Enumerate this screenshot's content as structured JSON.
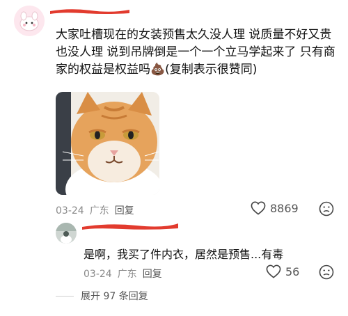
{
  "comment": {
    "text": "大家吐槽现在的女装预售太久没人理 说质量不好又贵也没人理 说到吊牌倒是一个一个立马学起来了 只有商家的权益是权益吗",
    "emoji": "💩",
    "text_suffix": "(复制表示很赞同)",
    "date": "03-24",
    "location": "广东",
    "reply_label": "回复",
    "likes": "8869",
    "icons": {
      "like": "heart-icon",
      "dislike": "dislike-face-icon"
    }
  },
  "reply": {
    "text": "是啊，我买了件内衣，居然是预售...有毒",
    "date": "03-24",
    "location": "广东",
    "reply_label": "回复",
    "likes": "56"
  },
  "expand": {
    "label": "展开 97 条回复"
  },
  "colors": {
    "redaction": "#e23b2e",
    "meta": "#8a8a8a"
  }
}
